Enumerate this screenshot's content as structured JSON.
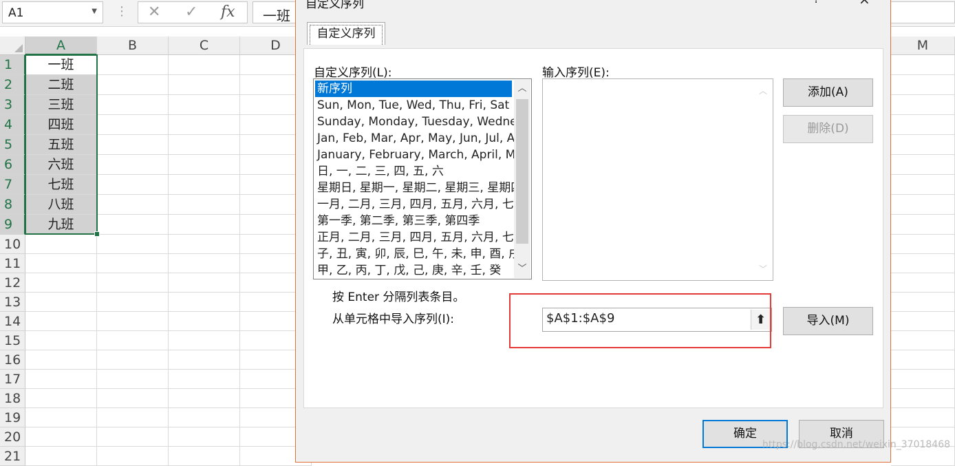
{
  "formula_bar": {
    "name_box": "A1",
    "cancel_icon": "✕",
    "enter_icon": "✓",
    "fx_label": "fx",
    "formula_value": "一班"
  },
  "grid": {
    "columns": [
      "A",
      "B",
      "C",
      "D",
      "M"
    ],
    "rows": [
      "1",
      "2",
      "3",
      "4",
      "5",
      "6",
      "7",
      "8",
      "9",
      "10",
      "11",
      "12",
      "13",
      "14",
      "15",
      "16",
      "17",
      "18",
      "19",
      "20",
      "21"
    ],
    "cells_A": [
      "一班",
      "二班",
      "三班",
      "四班",
      "五班",
      "六班",
      "七班",
      "八班",
      "九班"
    ]
  },
  "dialog": {
    "title": "自定义序列",
    "help": "?",
    "close": "×",
    "tab": "自定义序列",
    "list_label": "自定义序列(L):",
    "entries_label": "输入序列(E):",
    "lists": [
      "新序列",
      "Sun, Mon, Tue, Wed, Thu, Fri, Sat",
      "Sunday, Monday, Tuesday, Wednesday",
      "Jan, Feb, Mar, Apr, May, Jun, Jul, Aug",
      "January, February, March, April, May",
      "日, 一, 二, 三, 四, 五, 六",
      "星期日, 星期一, 星期二, 星期三, 星期四",
      "一月, 二月, 三月, 四月, 五月, 六月, 七月",
      "第一季, 第二季, 第三季, 第四季",
      "正月, 二月, 三月, 四月, 五月, 六月, 七月",
      "子, 丑, 寅, 卯, 辰, 巳, 午, 未, 申, 酉, 戌",
      "甲, 乙, 丙, 丁, 戊, 己, 庚, 辛, 壬, 癸"
    ],
    "add_button": "添加(A)",
    "delete_button": "删除(D)",
    "hint": "按 Enter 分隔列表条目。",
    "import_label": "从单元格中导入序列(I):",
    "import_range": "$A$1:$A$9",
    "import_button": "导入(M)",
    "ok_button": "确定",
    "cancel_button": "取消"
  },
  "watermark": "https://blog.csdn.net/weixin_37018468",
  "colors": {
    "excel_green": "#217346",
    "selection_blue": "#0078d7",
    "highlight_red": "#e53935"
  }
}
